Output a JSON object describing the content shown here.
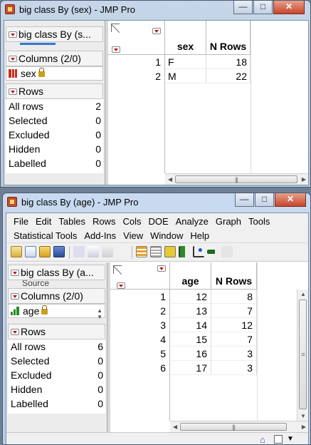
{
  "window1": {
    "title": "big class By (sex) - JMP Pro",
    "controls": {
      "minimize": "—",
      "maximize": "□",
      "close": "✕"
    },
    "panel_title": "big class By (s...",
    "columns_header": "Columns (2/0)",
    "column": "sex",
    "rows_header": "Rows",
    "rows": [
      {
        "label": "All rows",
        "value": "2"
      },
      {
        "label": "Selected",
        "value": "0"
      },
      {
        "label": "Excluded",
        "value": "0"
      },
      {
        "label": "Hidden",
        "value": "0"
      },
      {
        "label": "Labelled",
        "value": "0"
      }
    ],
    "table": {
      "headers": [
        "sex",
        "N Rows"
      ],
      "rows": [
        {
          "n": "1",
          "cells": [
            "F",
            "18"
          ]
        },
        {
          "n": "2",
          "cells": [
            "M",
            "22"
          ]
        }
      ]
    }
  },
  "window2": {
    "title": "big class By (age) - JMP Pro",
    "controls": {
      "minimize": "—",
      "maximize": "□",
      "close": "✕"
    },
    "menu_row1": [
      "File",
      "Edit",
      "Tables",
      "Rows",
      "Cols",
      "DOE",
      "Analyze",
      "Graph",
      "Tools"
    ],
    "menu_row2": [
      "Statistical Tools",
      "Add-Ins",
      "View",
      "Window",
      "Help"
    ],
    "toolbar_icons": [
      "new-table-icon",
      "new-script-icon",
      "open-icon",
      "save-icon",
      "cut-icon",
      "copy-icon",
      "paste-icon",
      "data-grid-icon",
      "journal-icon",
      "layout-icon",
      "distribution-icon",
      "fit-y-by-x-icon",
      "fit-model-icon",
      "edit-icon"
    ],
    "panel_title": "big class By (a...",
    "panel_sub": "Source",
    "columns_header": "Columns (2/0)",
    "column": "age",
    "rows_header": "Rows",
    "rows": [
      {
        "label": "All rows",
        "value": "6"
      },
      {
        "label": "Selected",
        "value": "0"
      },
      {
        "label": "Excluded",
        "value": "0"
      },
      {
        "label": "Hidden",
        "value": "0"
      },
      {
        "label": "Labelled",
        "value": "0"
      }
    ],
    "table": {
      "headers": [
        "age",
        "N Rows"
      ],
      "rows": [
        {
          "n": "1",
          "cells": [
            "12",
            "8"
          ]
        },
        {
          "n": "2",
          "cells": [
            "13",
            "7"
          ]
        },
        {
          "n": "3",
          "cells": [
            "14",
            "12"
          ]
        },
        {
          "n": "4",
          "cells": [
            "15",
            "7"
          ]
        },
        {
          "n": "5",
          "cells": [
            "16",
            "3"
          ]
        },
        {
          "n": "6",
          "cells": [
            "17",
            "3"
          ]
        }
      ]
    }
  },
  "colors": {
    "red_triangle": "#c0141c",
    "lock": "#c8a020"
  }
}
